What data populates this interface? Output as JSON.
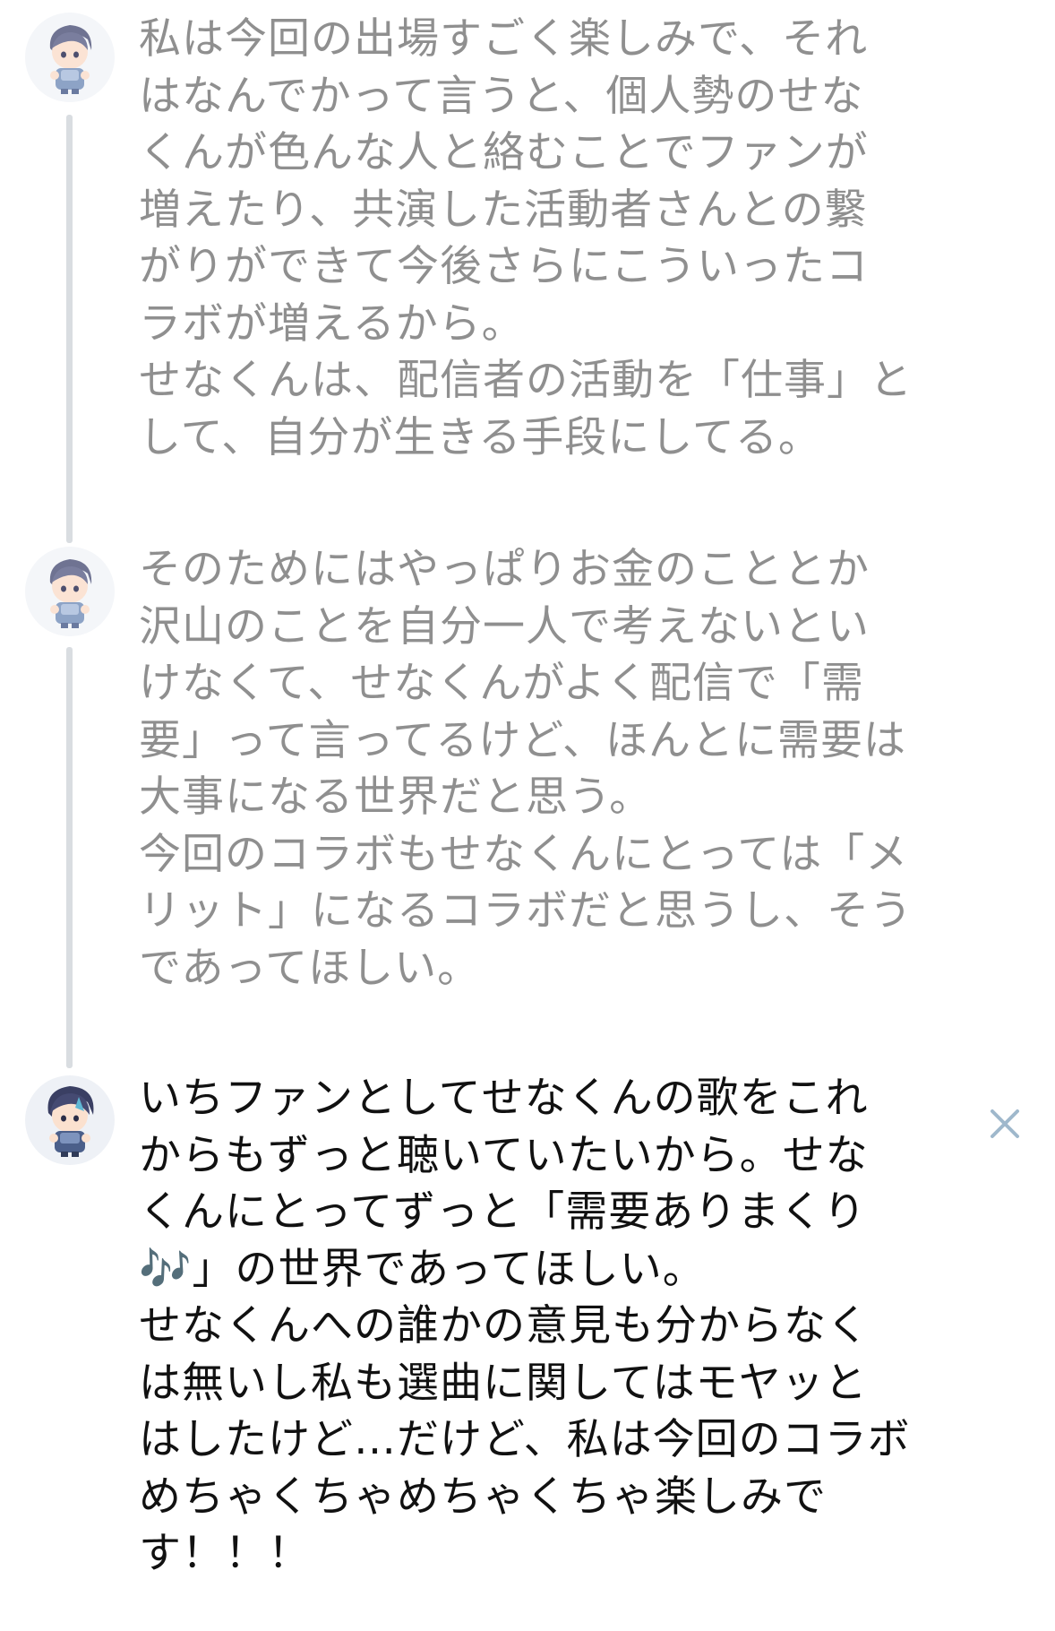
{
  "colors": {
    "faded_text": "#8f8f8f",
    "active_text": "#111111",
    "thread_line": "#d9dde1",
    "close_icon": "#9fb8cc"
  },
  "posts": [
    {
      "avatar_icon": "chibi-character-avatar-icon",
      "state": "faded",
      "text": "私は今回の出場すごく楽しみで、それ\nはなんでかって言うと、個人勢のせな\nくんが色んな人と絡むことでファンが\n増えたり、共演した活動者さんとの繋\nがりができて今後さらにこういったコ\nラボが増えるから。\nせなくんは、配信者の活動を「仕事」と\nして、自分が生きる手段にしてる。"
    },
    {
      "avatar_icon": "chibi-character-avatar-icon",
      "state": "faded",
      "text": "そのためにはやっぱりお金のこととか\n沢山のことを自分一人で考えないとい\nけなくて、せなくんがよく配信で「需\n要」って言ってるけど、ほんとに需要は\n大事になる世界だと思う。\n今回のコラボもせなくんにとっては「メ\nリット」になるコラボだと思うし、そう\nであってほしい。"
    },
    {
      "avatar_icon": "chibi-character-avatar-icon",
      "state": "active",
      "text": "いちファンとしてせなくんの歌をこれ\nからもずっと聴いていたいから。せな\nくんにとってずっと「需要ありまくり\n🎶」の世界であってほしい。\nせなくんへの誰かの意見も分からなく\nは無いし私も選曲に関してはモヤッと\nはしたけど…だけど、私は今回のコラボ\nめちゃくちゃめちゃくちゃ楽しみで\nす！！！"
    }
  ],
  "close_button": {
    "icon": "close-icon"
  }
}
